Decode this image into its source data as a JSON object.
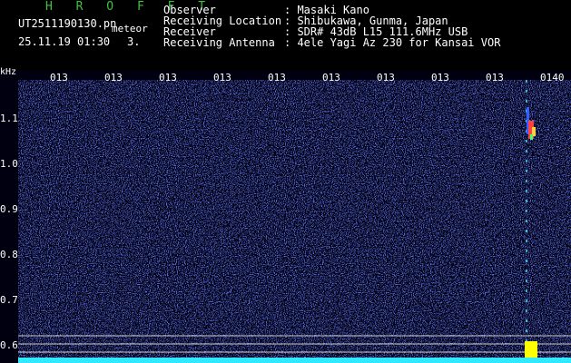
{
  "app": {
    "title": "H R O F F T"
  },
  "file": {
    "name": "UT2511190130.pn",
    "tag": "meteor",
    "datetime": "25.11.19 01:30",
    "count": "3."
  },
  "info": [
    {
      "label": "Observer",
      "value": ": Masaki Kano"
    },
    {
      "label": "Receiving Location",
      "value": ": Shibukawa, Gunma, Japan"
    },
    {
      "label": "Receiver",
      "value": ": SDR# 43dB L15 111.6MHz USB"
    },
    {
      "label": "Receiving Antenna",
      "value": ": 4ele Yagi Az 230 for Kansai VOR"
    }
  ],
  "axis": {
    "unit": "kHz",
    "y_ticks": [
      "1.1",
      "1.0",
      "0.9",
      "0.8",
      "0.7",
      "0.6"
    ],
    "x_ticks": [
      "013",
      "013",
      "013",
      "013",
      "013",
      "013",
      "013",
      "013",
      "013",
      "0140"
    ]
  },
  "colors": {
    "background": "#000000",
    "noise": "#2838c8",
    "trace": "#30e8ff",
    "echo": "#ff4040",
    "baseline": "#ffff00"
  }
}
